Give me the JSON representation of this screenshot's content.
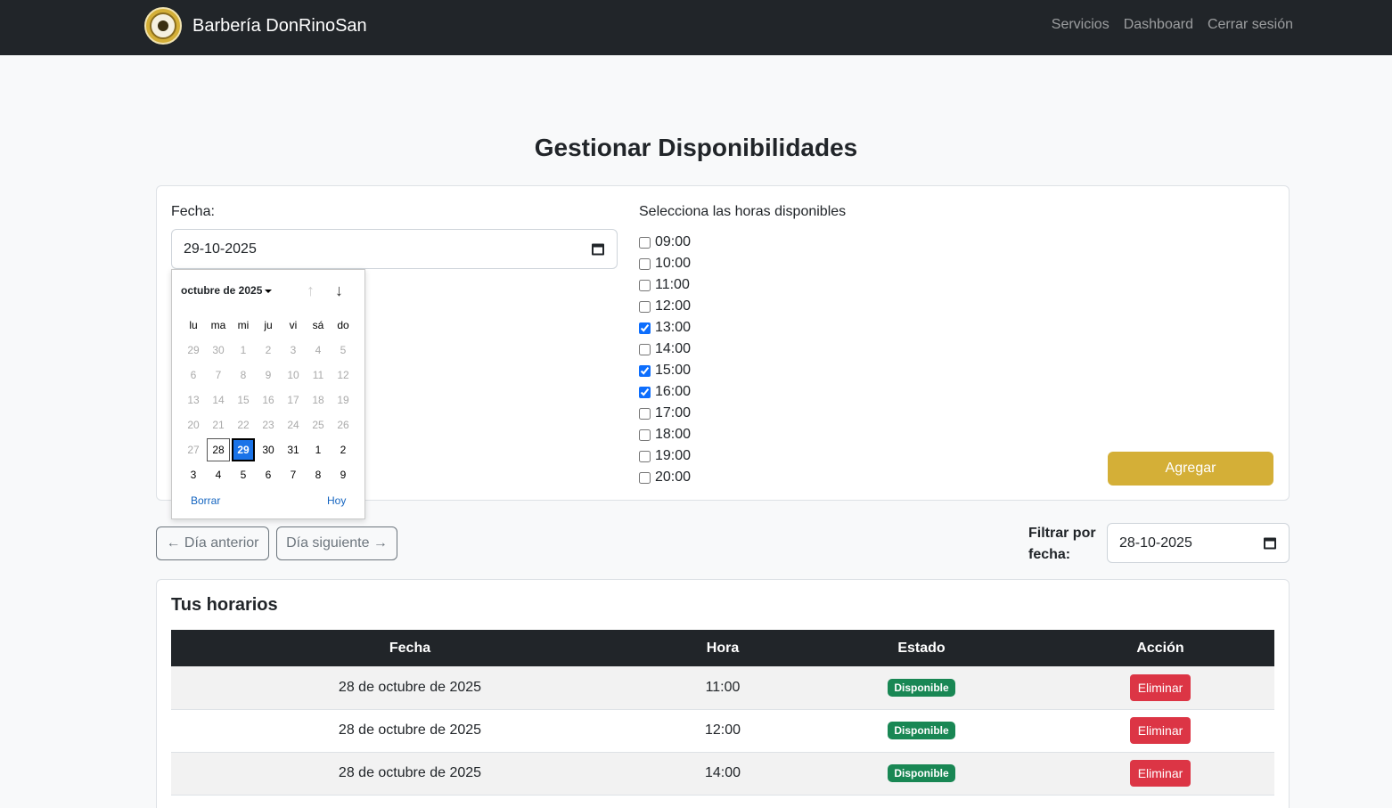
{
  "nav": {
    "brand": "Barbería DonRinoSan",
    "links": [
      "Servicios",
      "Dashboard",
      "Cerrar sesión"
    ]
  },
  "page": {
    "title": "Gestionar Disponibilidades"
  },
  "form": {
    "date_label": "Fecha:",
    "date_value": "29-10-2025",
    "hours_label": "Selecciona las horas disponibles",
    "hours": [
      {
        "label": "09:00",
        "checked": false
      },
      {
        "label": "10:00",
        "checked": false
      },
      {
        "label": "11:00",
        "checked": false
      },
      {
        "label": "12:00",
        "checked": false
      },
      {
        "label": "13:00",
        "checked": true
      },
      {
        "label": "14:00",
        "checked": false
      },
      {
        "label": "15:00",
        "checked": true
      },
      {
        "label": "16:00",
        "checked": true
      },
      {
        "label": "17:00",
        "checked": false
      },
      {
        "label": "18:00",
        "checked": false
      },
      {
        "label": "19:00",
        "checked": false
      },
      {
        "label": "20:00",
        "checked": false
      }
    ],
    "submit_label": "Agregar"
  },
  "datepicker": {
    "month_label": "octubre de 2025",
    "weekdays": [
      "lu",
      "ma",
      "mi",
      "ju",
      "vi",
      "sá",
      "do"
    ],
    "days": [
      {
        "d": "29",
        "s": "other"
      },
      {
        "d": "30",
        "s": "other"
      },
      {
        "d": "1",
        "s": "other"
      },
      {
        "d": "2",
        "s": "other"
      },
      {
        "d": "3",
        "s": "other"
      },
      {
        "d": "4",
        "s": "other"
      },
      {
        "d": "5",
        "s": "other"
      },
      {
        "d": "6",
        "s": "other"
      },
      {
        "d": "7",
        "s": "other"
      },
      {
        "d": "8",
        "s": "other"
      },
      {
        "d": "9",
        "s": "other"
      },
      {
        "d": "10",
        "s": "other"
      },
      {
        "d": "11",
        "s": "other"
      },
      {
        "d": "12",
        "s": "other"
      },
      {
        "d": "13",
        "s": "other"
      },
      {
        "d": "14",
        "s": "other"
      },
      {
        "d": "15",
        "s": "other"
      },
      {
        "d": "16",
        "s": "other"
      },
      {
        "d": "17",
        "s": "other"
      },
      {
        "d": "18",
        "s": "other"
      },
      {
        "d": "19",
        "s": "other"
      },
      {
        "d": "20",
        "s": "other"
      },
      {
        "d": "21",
        "s": "other"
      },
      {
        "d": "22",
        "s": "other"
      },
      {
        "d": "23",
        "s": "other"
      },
      {
        "d": "24",
        "s": "other"
      },
      {
        "d": "25",
        "s": "other"
      },
      {
        "d": "26",
        "s": "other"
      },
      {
        "d": "27",
        "s": "other"
      },
      {
        "d": "28",
        "s": "today"
      },
      {
        "d": "29",
        "s": "sel"
      },
      {
        "d": "30",
        "s": "cur"
      },
      {
        "d": "31",
        "s": "cur"
      },
      {
        "d": "1",
        "s": "cur"
      },
      {
        "d": "2",
        "s": "cur"
      },
      {
        "d": "3",
        "s": "cur"
      },
      {
        "d": "4",
        "s": "cur"
      },
      {
        "d": "5",
        "s": "cur"
      },
      {
        "d": "6",
        "s": "cur"
      },
      {
        "d": "7",
        "s": "cur"
      },
      {
        "d": "8",
        "s": "cur"
      },
      {
        "d": "9",
        "s": "cur"
      }
    ],
    "clear_label": "Borrar",
    "today_label": "Hoy"
  },
  "controls": {
    "prev_day": "← Día anterior",
    "next_day": "Día siguiente →",
    "filter_label": "Filtrar por fecha:",
    "filter_value": "28-10-2025"
  },
  "schedule": {
    "title": "Tus horarios",
    "headers": [
      "Fecha",
      "Hora",
      "Estado",
      "Acción"
    ],
    "rows": [
      {
        "fecha": "28 de octubre de 2025",
        "hora": "11:00",
        "estado": "Disponible",
        "accion": "Eliminar"
      },
      {
        "fecha": "28 de octubre de 2025",
        "hora": "12:00",
        "estado": "Disponible",
        "accion": "Eliminar"
      },
      {
        "fecha": "28 de octubre de 2025",
        "hora": "14:00",
        "estado": "Disponible",
        "accion": "Eliminar"
      }
    ]
  },
  "colors": {
    "navbar": "#212529",
    "accent_gold": "#d4af37",
    "success": "#198754",
    "danger": "#dc3545",
    "selected_day": "#1a73e8"
  }
}
